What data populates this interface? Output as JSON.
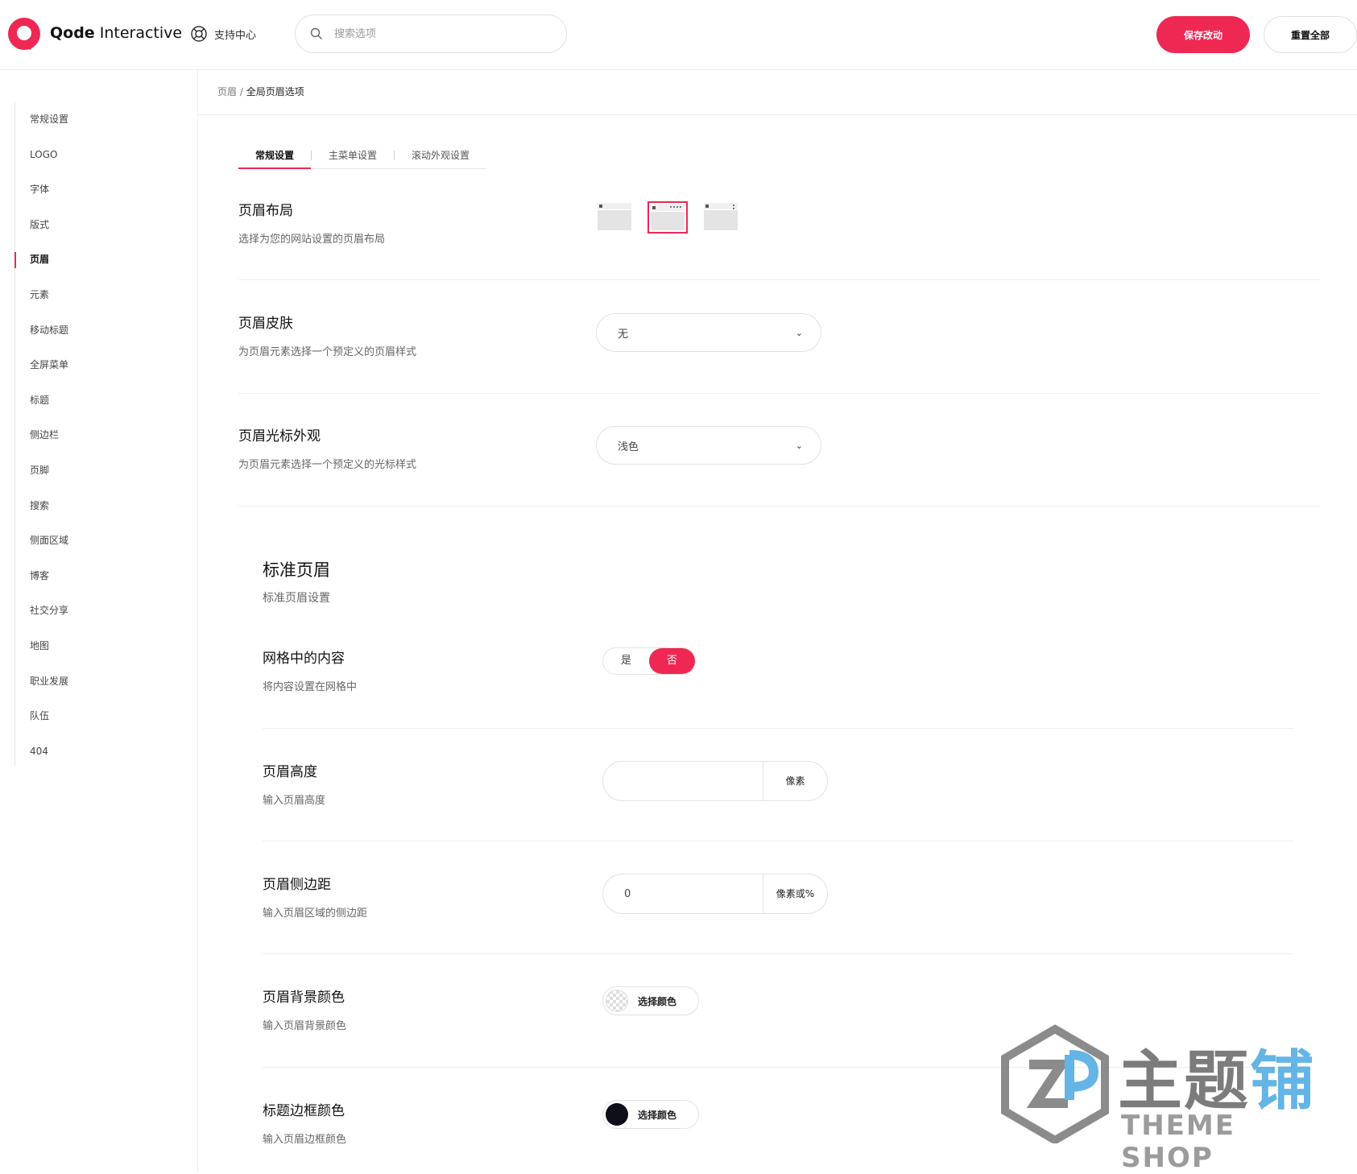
{
  "header": {
    "brand_bold": "Qode",
    "brand_rest": " Interactive",
    "support_label": "支持中心",
    "search_placeholder": "搜索选项",
    "save_label": "保存改动",
    "reset_label": "重置全部"
  },
  "sidebar": {
    "items": [
      "常规设置",
      "LOGO",
      "字体",
      "版式",
      "页眉",
      "元素",
      "移动标题",
      "全屏菜单",
      "标题",
      "侧边栏",
      "页脚",
      "搜索",
      "侧面区域",
      "博客",
      "社交分享",
      "地图",
      "职业发展",
      "队伍",
      "404"
    ],
    "active": "页眉"
  },
  "breadcrumb": {
    "parent": "页眉",
    "separator": " / ",
    "current": "全局页眉选项"
  },
  "tabs": [
    "常规设置",
    "主菜单设置",
    "滚动外观设置"
  ],
  "settings": {
    "layout": {
      "title": "页眉布局",
      "desc": "选择为您的网站设置的页眉布局",
      "selected_index": 1
    },
    "skin": {
      "title": "页眉皮肤",
      "desc": "为页眉元素选择一个预定义的页眉样式",
      "value": "无"
    },
    "cursor": {
      "title": "页眉光标外观",
      "desc": "为页眉元素选择一个预定义的光标样式",
      "value": "浅色"
    }
  },
  "standard_header": {
    "title": "标准页眉",
    "desc": "标准页眉设置",
    "grid": {
      "title": "网格中的内容",
      "desc": "将内容设置在网格中",
      "yes": "是",
      "no": "否",
      "selected": "否"
    },
    "height": {
      "title": "页眉高度",
      "desc": "输入页眉高度",
      "value": "",
      "unit": "像素"
    },
    "side_padding": {
      "title": "页眉侧边距",
      "desc": "输入页眉区域的侧边距",
      "value": "0",
      "unit": "像素或%"
    },
    "bg_color": {
      "title": "页眉背景颜色",
      "desc": "输入页眉背景颜色",
      "button": "选择颜色"
    },
    "border_color": {
      "title": "标题边框颜色",
      "desc": "输入页眉边框颜色",
      "button": "选择颜色"
    }
  },
  "watermark": {
    "cn_main": "主题",
    "cn_accent": "铺",
    "en": "THEME SHOP"
  },
  "colors": {
    "accent": "#ee2852",
    "border": "#e2e2e2",
    "swatch_dark": "#0f0f1a"
  }
}
